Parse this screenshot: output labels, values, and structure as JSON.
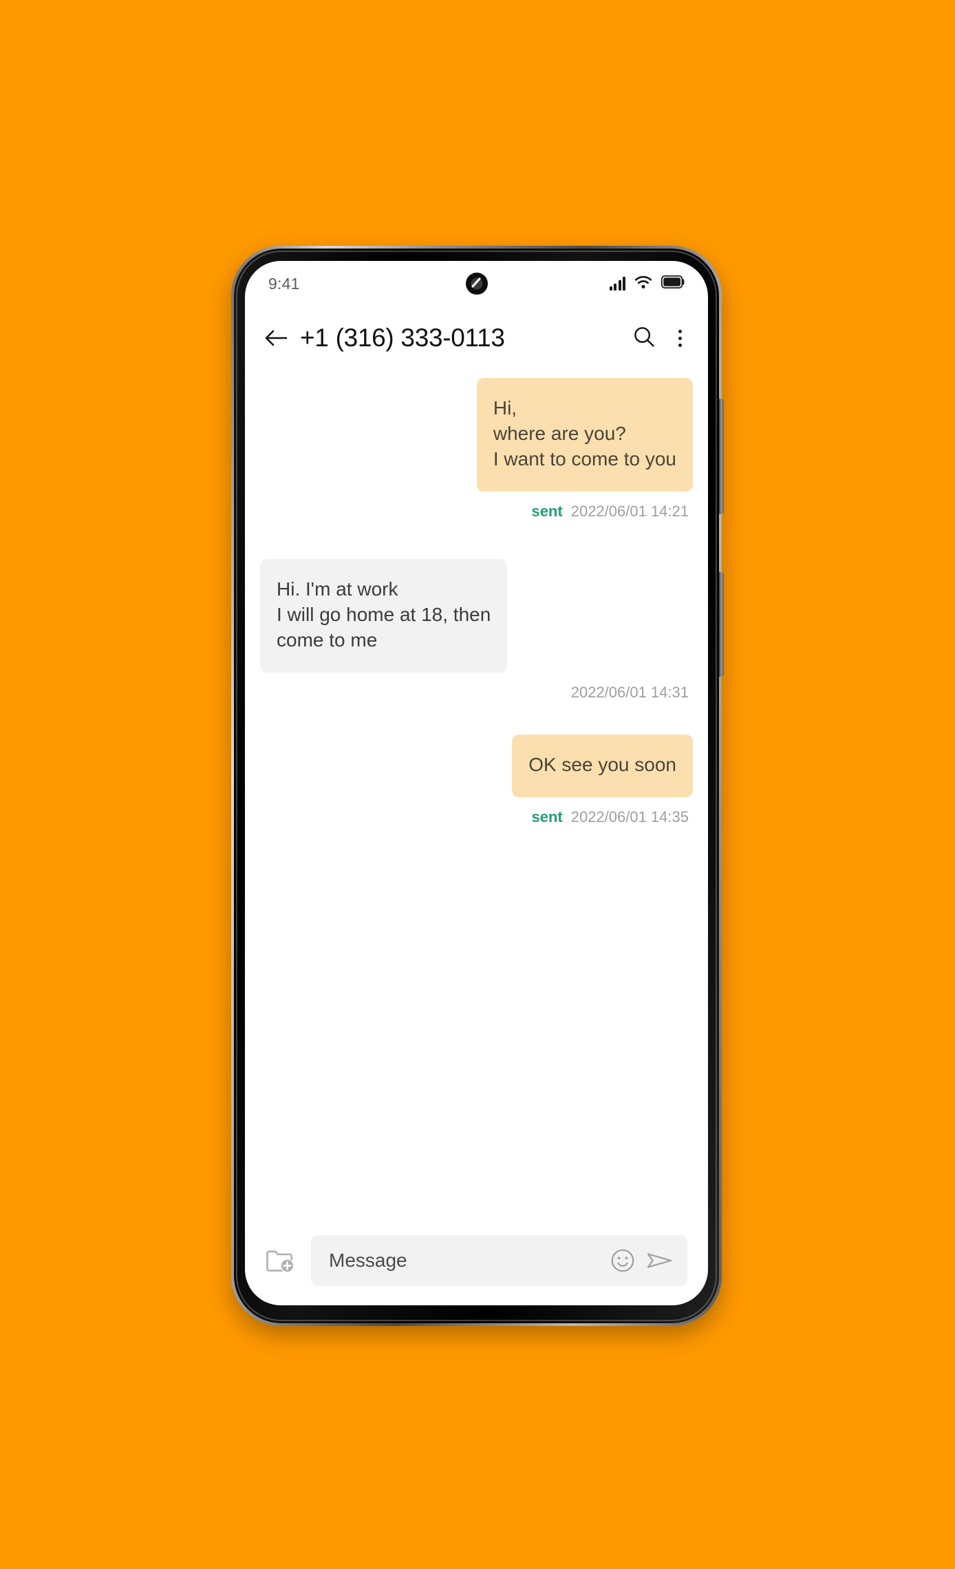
{
  "theme": {
    "background_color": "#FF9900",
    "outgoing_bubble_color": "#FBDFAE",
    "incoming_bubble_color": "#F2F2F2",
    "sent_status_color": "#22A06B",
    "timestamp_color": "#9E9E9E"
  },
  "status_bar": {
    "time": "9:41",
    "camera_icon": "camera-punch-hole-icon",
    "signal_icon": "cellular-signal-icon",
    "wifi_icon": "wifi-icon",
    "battery_icon": "battery-full-icon"
  },
  "app_bar": {
    "back_icon": "back-arrow-icon",
    "title": "+1 (316) 333-0113",
    "search_icon": "search-icon",
    "menu_icon": "overflow-menu-icon"
  },
  "conversation": {
    "messages": [
      {
        "direction": "outgoing",
        "text": "Hi,\nwhere are you?\nI want to come to you",
        "status": "sent",
        "timestamp": "2022/06/01 14:21"
      },
      {
        "direction": "incoming",
        "text": "Hi. I'm at work\nI will go home at 18, then\n come to me",
        "status": "",
        "timestamp": "2022/06/01 14:31"
      },
      {
        "direction": "outgoing",
        "text": "OK see you soon",
        "status": "sent",
        "timestamp": "2022/06/01 14:35"
      }
    ]
  },
  "composer": {
    "attach_icon": "folder-add-icon",
    "input_value": "",
    "placeholder": "Message",
    "emoji_icon": "emoji-smiley-icon",
    "send_icon": "send-icon"
  }
}
